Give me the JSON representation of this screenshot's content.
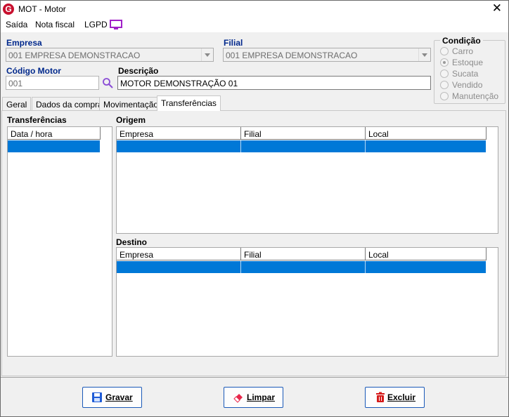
{
  "window": {
    "title": "MOT - Motor",
    "close_glyph": "✕",
    "logo_letter": "G"
  },
  "menu": {
    "items": [
      "Saída",
      "Nota fiscal",
      "LGPD"
    ]
  },
  "form": {
    "empresa_label": "Empresa",
    "empresa_value": "001 EMPRESA DEMONSTRACAO",
    "filial_label": "Filial",
    "filial_value": "001 EMPRESA DEMONSTRACAO",
    "codigo_label": "Código Motor",
    "codigo_value": "001",
    "descricao_label": "Descrição",
    "descricao_value": "MOTOR DEMONSTRAÇÃO 01"
  },
  "condicao": {
    "title": "Condição",
    "options": [
      {
        "label": "Carro",
        "checked": false
      },
      {
        "label": "Estoque",
        "checked": true
      },
      {
        "label": "Sucata",
        "checked": false
      },
      {
        "label": "Vendido",
        "checked": false
      },
      {
        "label": "Manutenção",
        "checked": false
      }
    ]
  },
  "tabs": [
    {
      "label": "Geral",
      "active": false
    },
    {
      "label": "Dados da compra",
      "active": false
    },
    {
      "label": "Movimentação",
      "active": false
    },
    {
      "label": "Transferências",
      "active": true
    }
  ],
  "transferencias": {
    "label": "Transferências",
    "column": "Data / hora"
  },
  "origem": {
    "label": "Origem",
    "columns": [
      "Empresa",
      "Filial",
      "Local"
    ]
  },
  "destino": {
    "label": "Destino",
    "columns": [
      "Empresa",
      "Filial",
      "Local"
    ]
  },
  "buttons": {
    "save": "Gravar",
    "clear": "Limpar",
    "delete": "Excluir"
  },
  "colors": {
    "accent_blue": "#0078d7",
    "label_blue": "#00288c",
    "logo_red": "#c8102e",
    "lgpd_icon": "#a020c8"
  }
}
